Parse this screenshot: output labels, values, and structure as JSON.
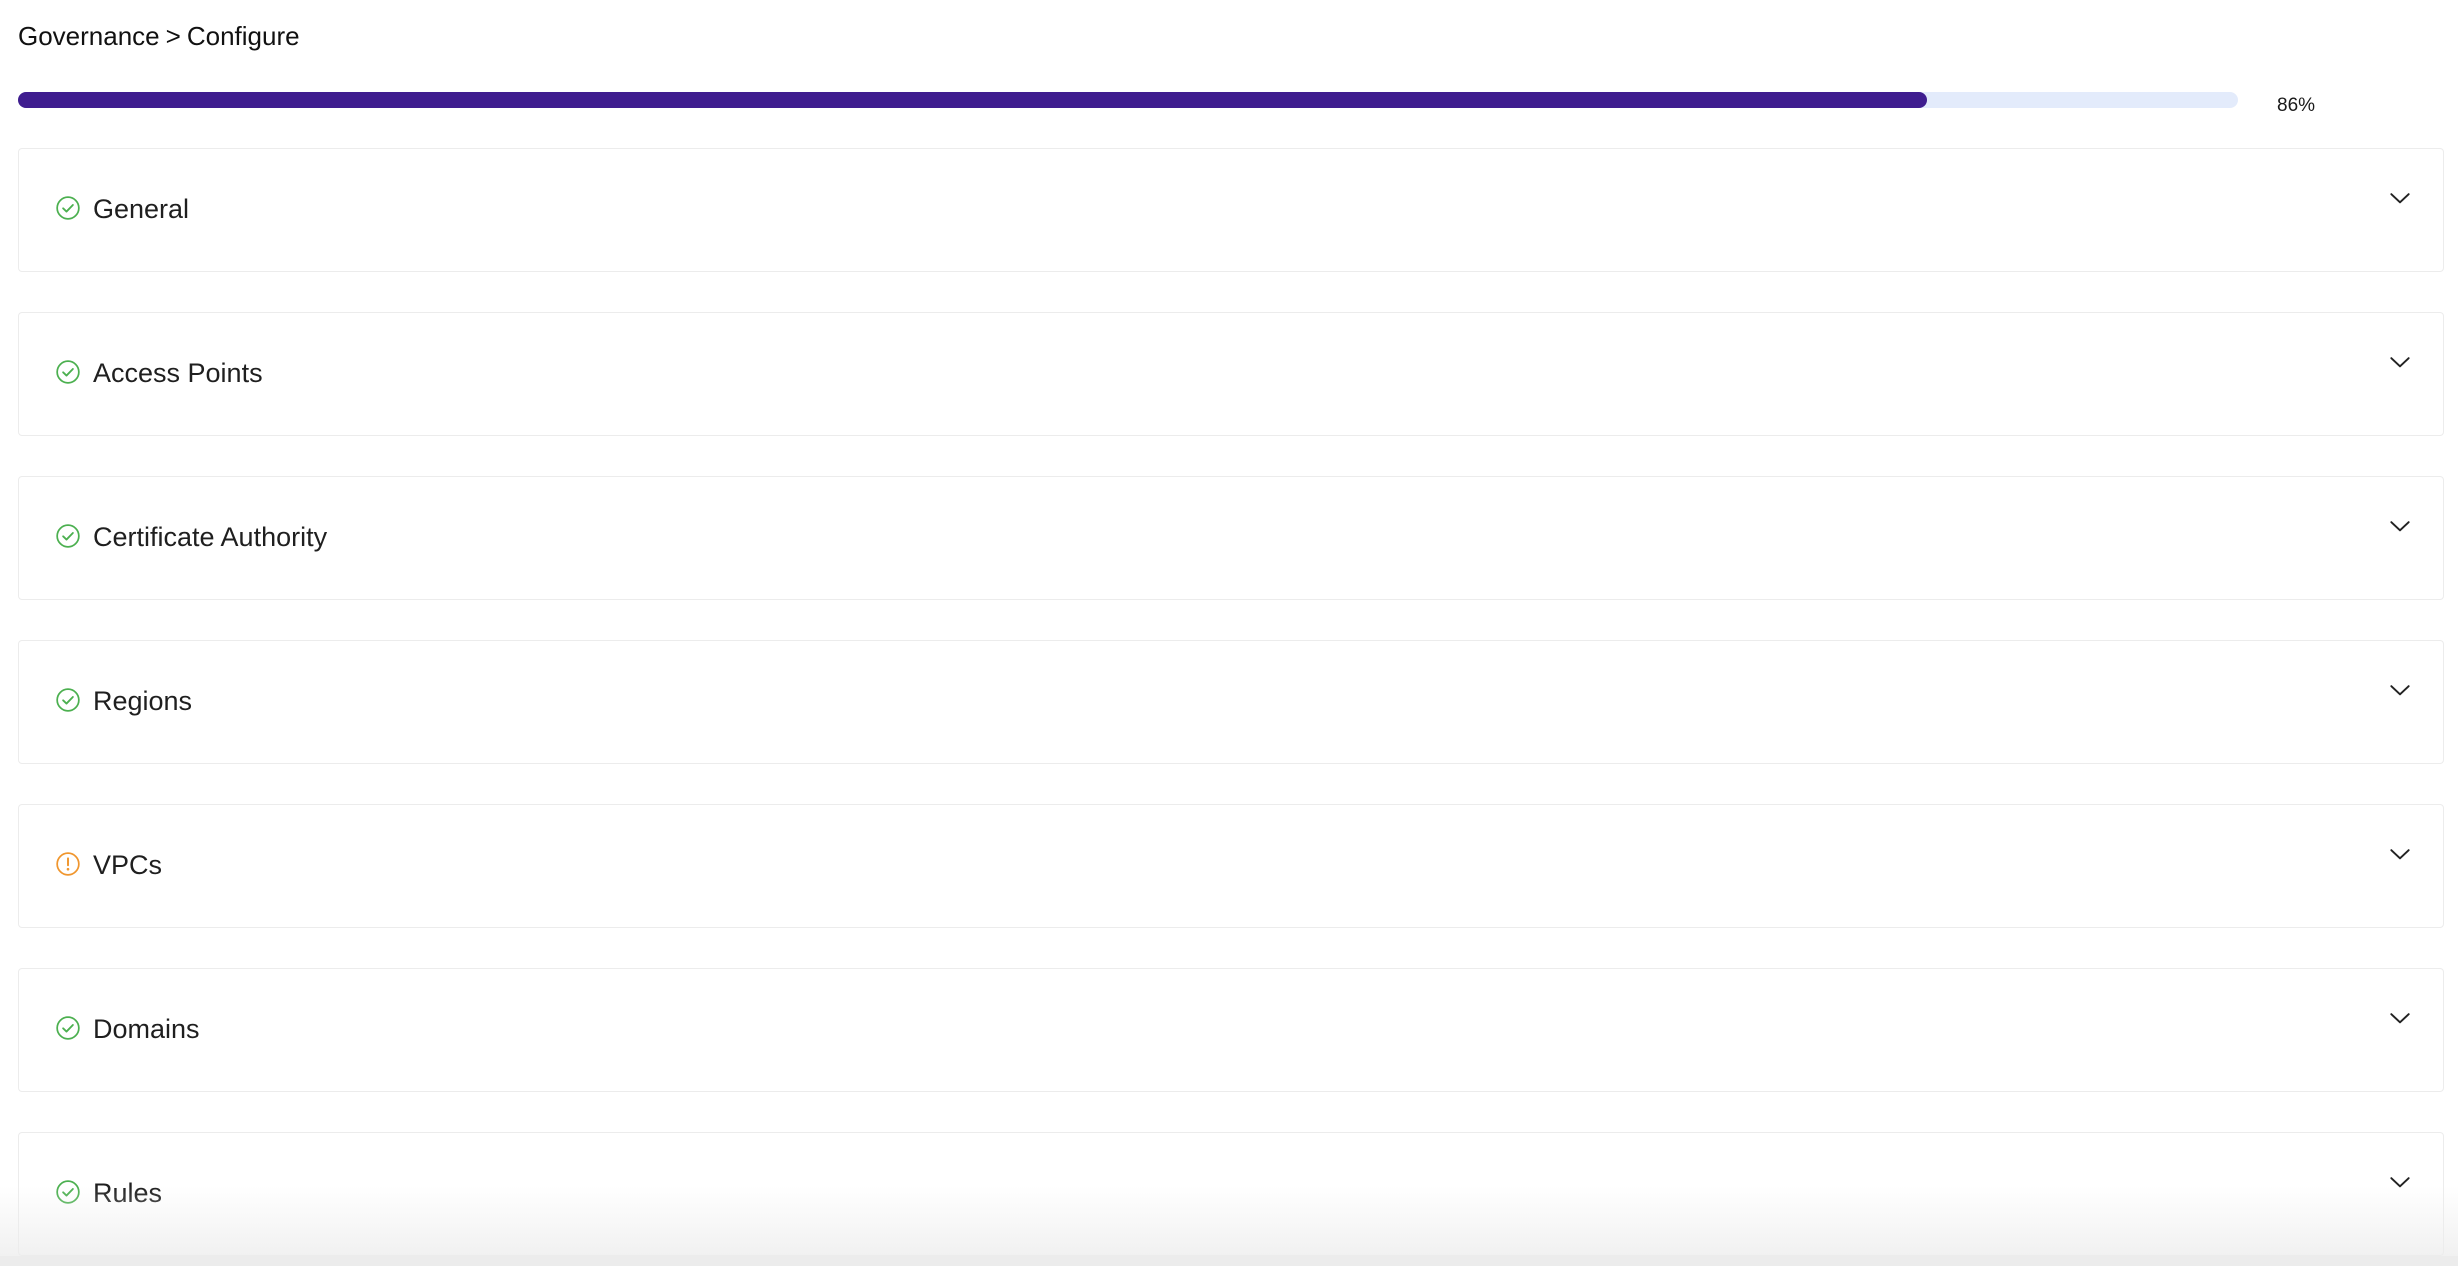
{
  "breadcrumb": {
    "parent": "Governance",
    "separator": ">",
    "current": "Configure"
  },
  "progress": {
    "value": 86,
    "label": "86%",
    "fill_color": "#3f1d8f",
    "track_color": "#e3ebfb"
  },
  "status_colors": {
    "complete": "#4cb050",
    "warning": "#f0962e"
  },
  "sections": [
    {
      "title": "General",
      "status": "complete",
      "icon": "check-circle-icon"
    },
    {
      "title": "Access Points",
      "status": "complete",
      "icon": "check-circle-icon"
    },
    {
      "title": "Certificate Authority",
      "status": "complete",
      "icon": "check-circle-icon"
    },
    {
      "title": "Regions",
      "status": "complete",
      "icon": "check-circle-icon"
    },
    {
      "title": "VPCs",
      "status": "warning",
      "icon": "exclamation-circle-icon"
    },
    {
      "title": "Domains",
      "status": "complete",
      "icon": "check-circle-icon"
    },
    {
      "title": "Rules",
      "status": "complete",
      "icon": "check-circle-icon"
    }
  ],
  "expand_icon": "chevron-down-icon"
}
